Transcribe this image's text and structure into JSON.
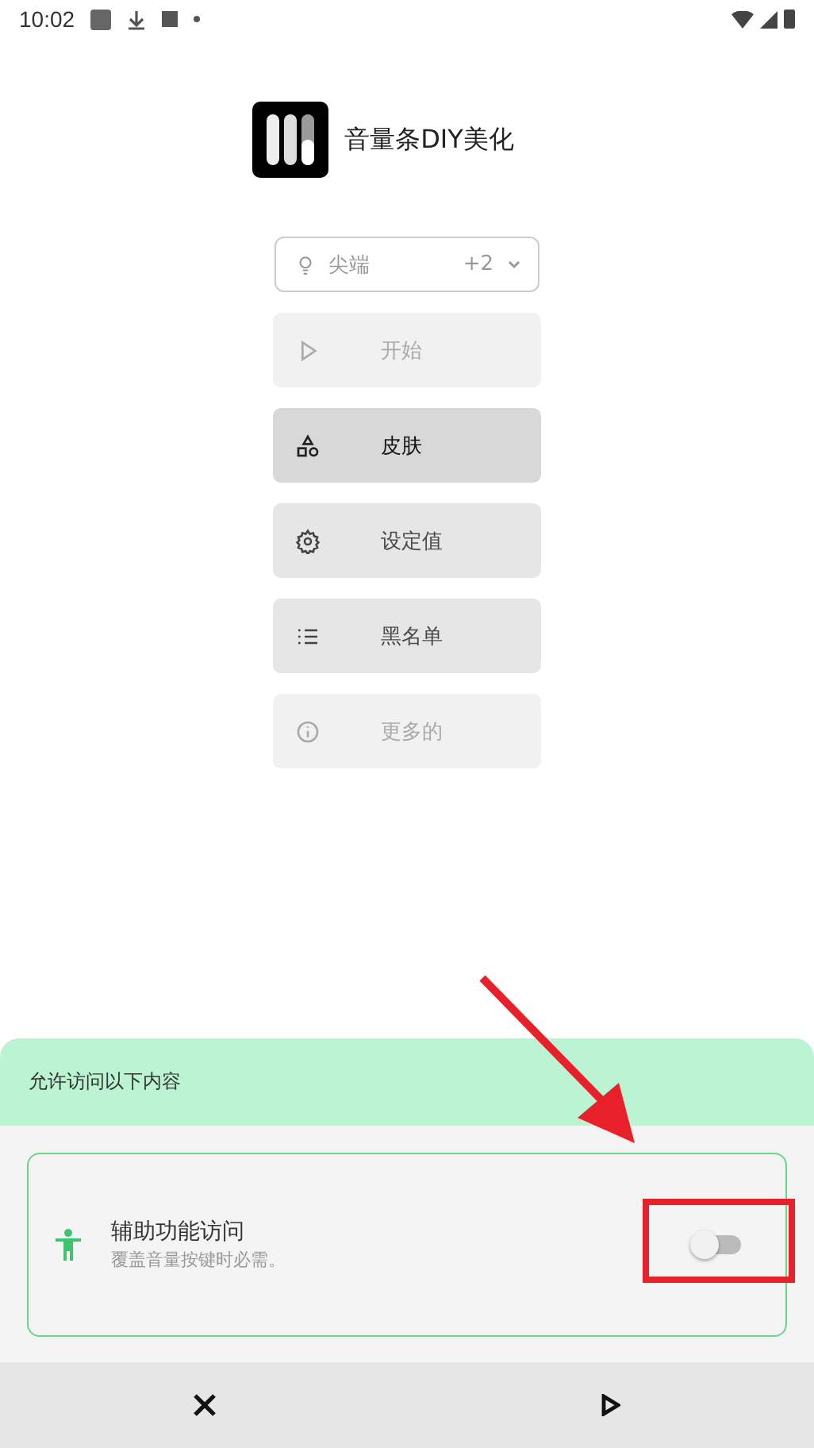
{
  "status_bar": {
    "time": "10:02"
  },
  "app": {
    "title": "音量条DIY美化"
  },
  "style_picker": {
    "value": "尖端",
    "extra_count": "+2"
  },
  "menu": [
    {
      "kind": "play",
      "label": "开始",
      "selected": false,
      "disabled": true
    },
    {
      "kind": "shapes",
      "label": "皮肤",
      "selected": true,
      "disabled": false
    },
    {
      "kind": "gear",
      "label": "设定值",
      "selected": false,
      "disabled": false
    },
    {
      "kind": "list",
      "label": "黑名单",
      "selected": false,
      "disabled": false
    },
    {
      "kind": "info",
      "label": "更多的",
      "selected": false,
      "disabled": true
    }
  ],
  "permission_sheet": {
    "title": "允许访问以下内容",
    "permissions": [
      {
        "title": "辅助功能访问",
        "description": "覆盖音量按键时必需。",
        "on": false
      }
    ]
  }
}
